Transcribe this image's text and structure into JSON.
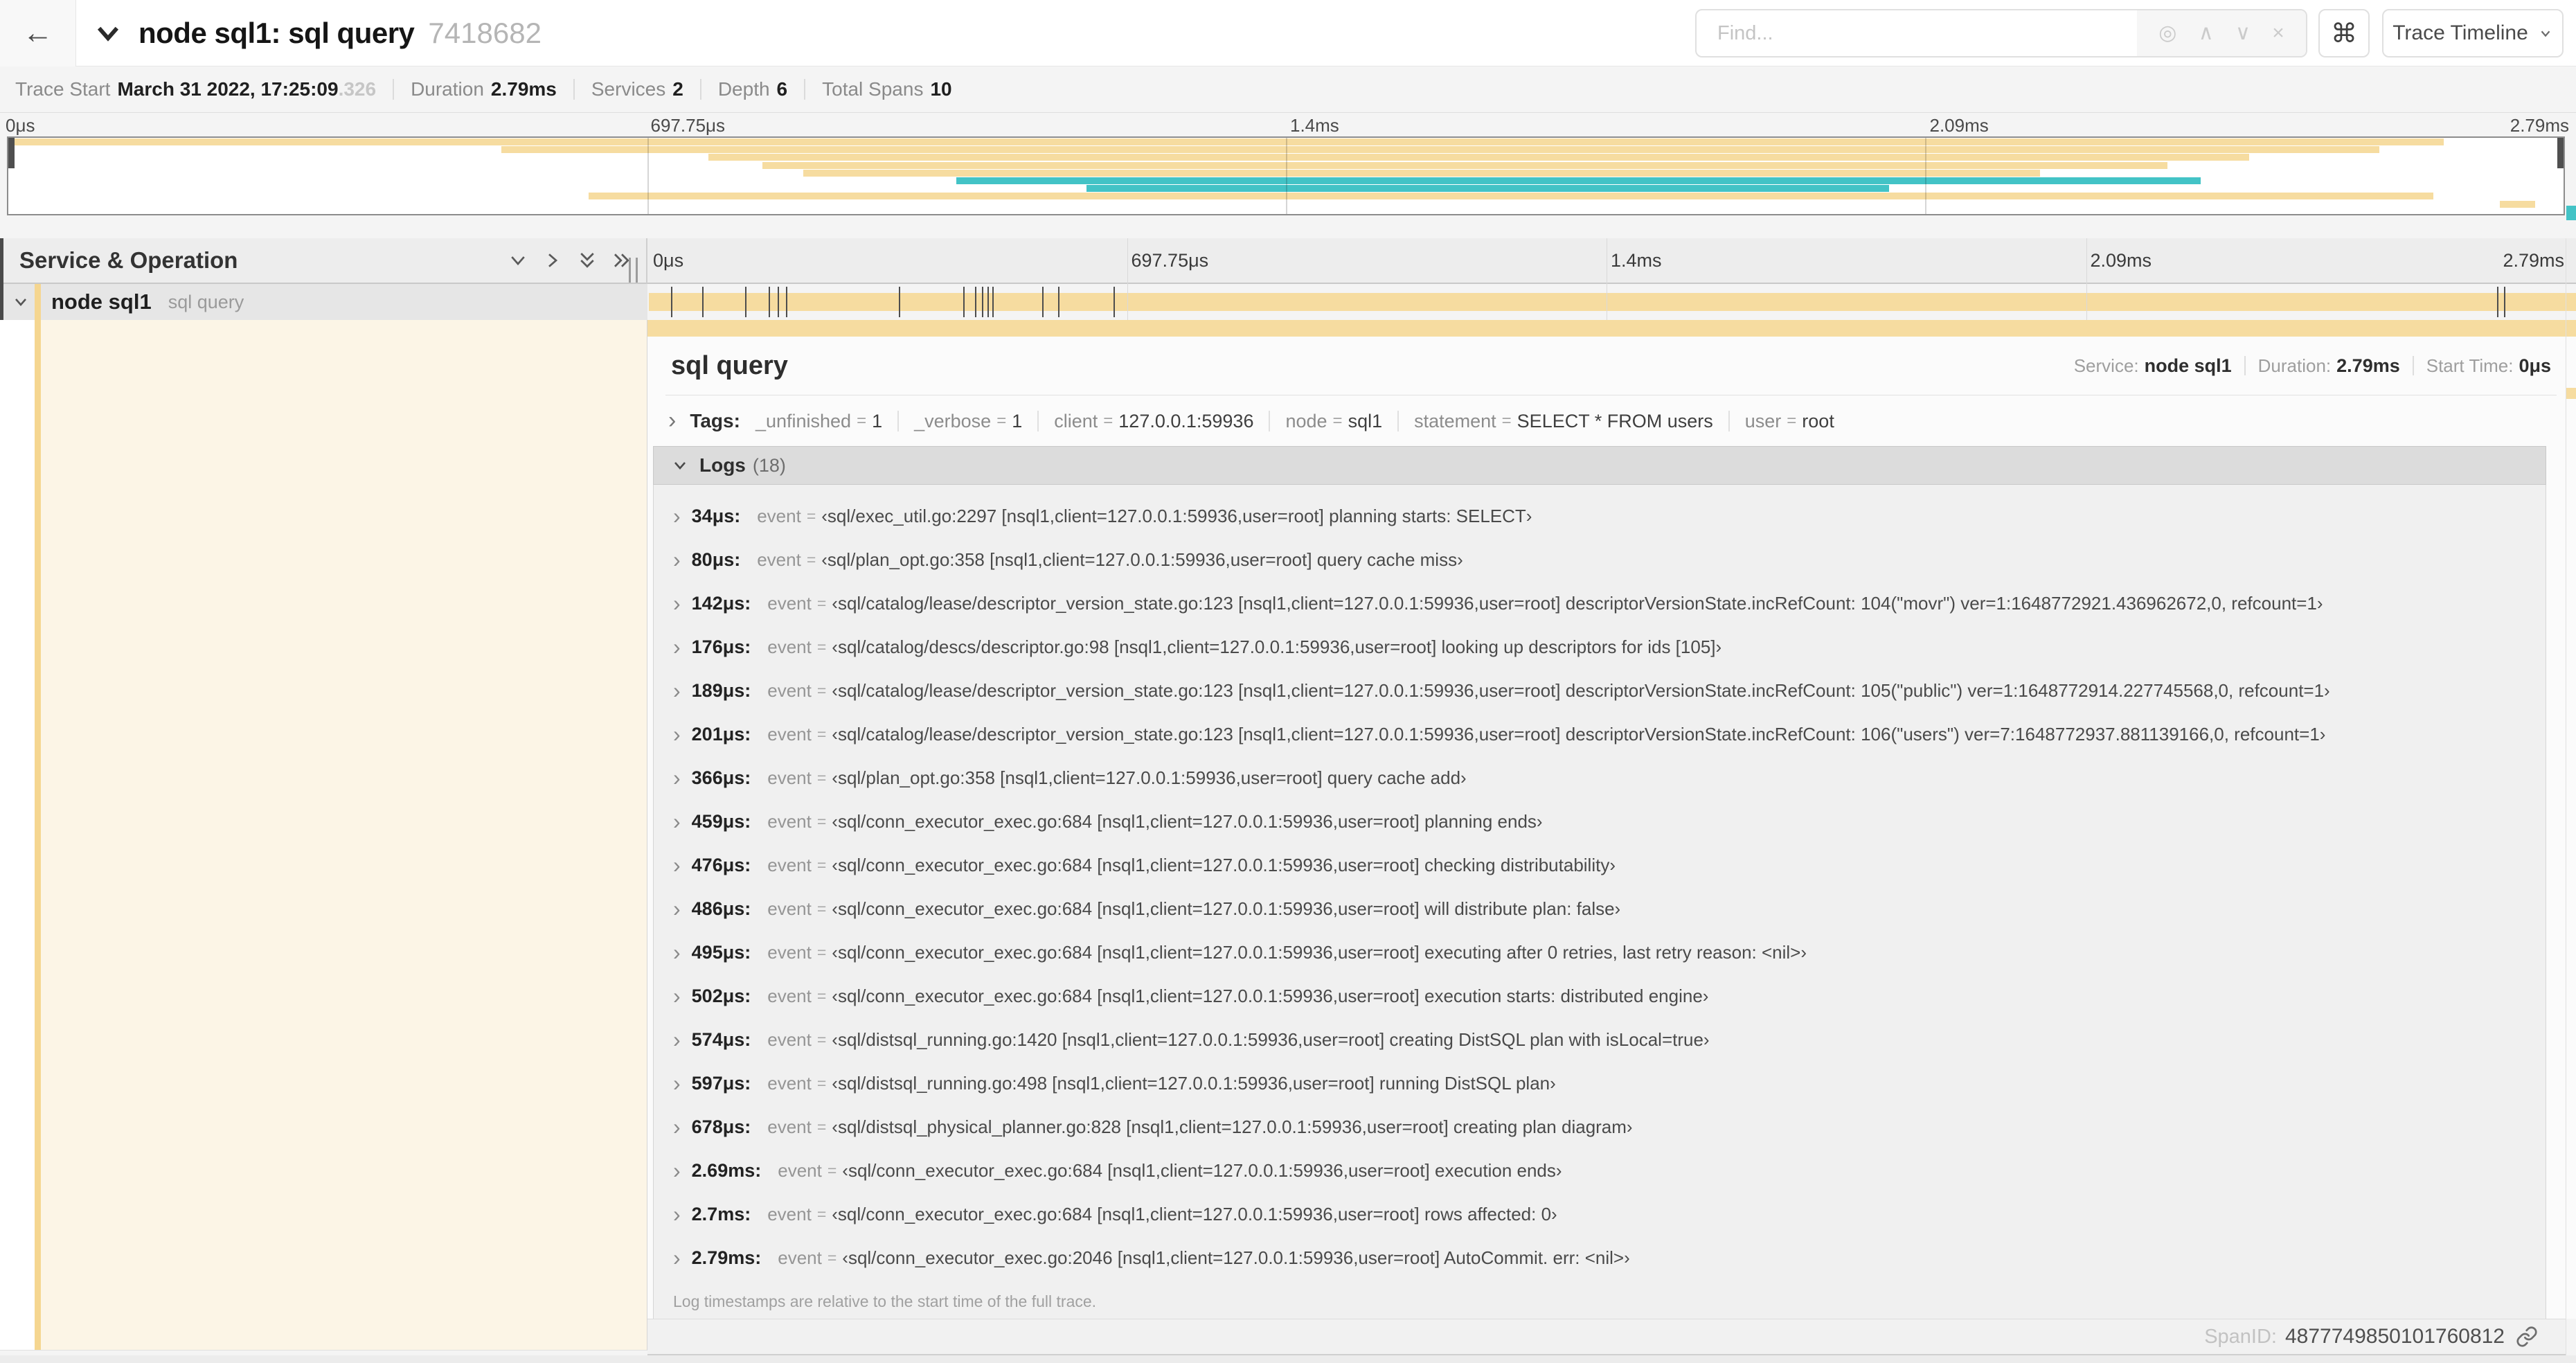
{
  "colors": {
    "span_tan": "#F6DCA0",
    "accent_tan": "#F5D690",
    "span_teal": "#43C3C6",
    "cream": "#FCF5E6"
  },
  "header": {
    "back_icon": "←",
    "title": "node sql1: sql query",
    "trace_id": "7418682",
    "find_placeholder": "Find...",
    "find_icons": [
      "◎",
      "∧",
      "∨",
      "×"
    ],
    "shortcut_icon": "⌘",
    "view_selector_label": "Trace Timeline"
  },
  "trace_info": {
    "items": [
      {
        "label": "Trace Start",
        "value": "March 31 2022, 17:25:09",
        "suffix": ".326"
      },
      {
        "label": "Duration",
        "value": "2.79ms"
      },
      {
        "label": "Services",
        "value": "2"
      },
      {
        "label": "Depth",
        "value": "6"
      },
      {
        "label": "Total Spans",
        "value": "10"
      }
    ]
  },
  "minimap": {
    "ticks": [
      "0μs",
      "697.75μs",
      "1.4ms",
      "2.09ms",
      "2.79ms"
    ],
    "spans": [
      {
        "row": 0,
        "start": 0,
        "end": 95.3,
        "color": "tan"
      },
      {
        "row": 1,
        "start": 19.3,
        "end": 92.8,
        "color": "tan"
      },
      {
        "row": 2,
        "start": 27.4,
        "end": 87.7,
        "color": "tan"
      },
      {
        "row": 3,
        "start": 29.5,
        "end": 84.5,
        "color": "tan"
      },
      {
        "row": 4,
        "start": 31.1,
        "end": 79.5,
        "color": "tan"
      },
      {
        "row": 5,
        "start": 37.1,
        "end": 85.8,
        "color": "teal"
      },
      {
        "row": 6,
        "start": 42.2,
        "end": 73.6,
        "color": "teal"
      },
      {
        "row": 7,
        "start": 22.7,
        "end": 94.9,
        "color": "tan"
      },
      {
        "row": 8,
        "start": 97.5,
        "end": 98.9,
        "color": "tan"
      }
    ]
  },
  "timeline": {
    "left_header": "Service & Operation",
    "ticks": [
      "0μs",
      "697.75μs",
      "1.4ms",
      "2.09ms",
      "2.79ms"
    ],
    "row": {
      "service": "node sql1",
      "operation": "sql query"
    },
    "duration_us": 2790,
    "log_markers_us": [
      34,
      80,
      142,
      176,
      189,
      201,
      366,
      459,
      476,
      486,
      495,
      502,
      574,
      597,
      678,
      2690,
      2700
    ]
  },
  "detail": {
    "operation": "sql query",
    "stats": [
      {
        "label": "Service:",
        "value": "node sql1"
      },
      {
        "label": "Duration:",
        "value": "2.79ms"
      },
      {
        "label": "Start Time:",
        "value": "0μs"
      }
    ],
    "tags_label": "Tags:",
    "tags": [
      {
        "key": "_unfinished",
        "value": "1"
      },
      {
        "key": "_verbose",
        "value": "1"
      },
      {
        "key": "client",
        "value": "127.0.0.1:59936"
      },
      {
        "key": "node",
        "value": "sql1"
      },
      {
        "key": "statement",
        "value": "SELECT * FROM users"
      },
      {
        "key": "user",
        "value": "root"
      }
    ],
    "logs_label": "Logs",
    "logs_count": "(18)",
    "logs": [
      {
        "time": "34μs:",
        "key": "event",
        "value": "‹sql/exec_util.go:2297 [nsql1,client=127.0.0.1:59936,user=root] planning starts: SELECT›"
      },
      {
        "time": "80μs:",
        "key": "event",
        "value": "‹sql/plan_opt.go:358 [nsql1,client=127.0.0.1:59936,user=root] query cache miss›"
      },
      {
        "time": "142μs:",
        "key": "event",
        "value": "‹sql/catalog/lease/descriptor_version_state.go:123 [nsql1,client=127.0.0.1:59936,user=root] descriptorVersionState.incRefCount: 104(\"movr\") ver=1:1648772921.436962672,0, refcount=1›"
      },
      {
        "time": "176μs:",
        "key": "event",
        "value": "‹sql/catalog/descs/descriptor.go:98 [nsql1,client=127.0.0.1:59936,user=root] looking up descriptors for ids [105]›"
      },
      {
        "time": "189μs:",
        "key": "event",
        "value": "‹sql/catalog/lease/descriptor_version_state.go:123 [nsql1,client=127.0.0.1:59936,user=root] descriptorVersionState.incRefCount: 105(\"public\") ver=1:1648772914.227745568,0, refcount=1›"
      },
      {
        "time": "201μs:",
        "key": "event",
        "value": "‹sql/catalog/lease/descriptor_version_state.go:123 [nsql1,client=127.0.0.1:59936,user=root] descriptorVersionState.incRefCount: 106(\"users\") ver=7:1648772937.881139166,0, refcount=1›"
      },
      {
        "time": "366μs:",
        "key": "event",
        "value": "‹sql/plan_opt.go:358 [nsql1,client=127.0.0.1:59936,user=root] query cache add›"
      },
      {
        "time": "459μs:",
        "key": "event",
        "value": "‹sql/conn_executor_exec.go:684 [nsql1,client=127.0.0.1:59936,user=root] planning ends›"
      },
      {
        "time": "476μs:",
        "key": "event",
        "value": "‹sql/conn_executor_exec.go:684 [nsql1,client=127.0.0.1:59936,user=root] checking distributability›"
      },
      {
        "time": "486μs:",
        "key": "event",
        "value": "‹sql/conn_executor_exec.go:684 [nsql1,client=127.0.0.1:59936,user=root] will distribute plan: false›"
      },
      {
        "time": "495μs:",
        "key": "event",
        "value": "‹sql/conn_executor_exec.go:684 [nsql1,client=127.0.0.1:59936,user=root] executing after 0 retries, last retry reason: <nil>›"
      },
      {
        "time": "502μs:",
        "key": "event",
        "value": "‹sql/conn_executor_exec.go:684 [nsql1,client=127.0.0.1:59936,user=root] execution starts: distributed engine›"
      },
      {
        "time": "574μs:",
        "key": "event",
        "value": "‹sql/distsql_running.go:1420 [nsql1,client=127.0.0.1:59936,user=root] creating DistSQL plan with isLocal=true›"
      },
      {
        "time": "597μs:",
        "key": "event",
        "value": "‹sql/distsql_running.go:498 [nsql1,client=127.0.0.1:59936,user=root] running DistSQL plan›"
      },
      {
        "time": "678μs:",
        "key": "event",
        "value": "‹sql/distsql_physical_planner.go:828 [nsql1,client=127.0.0.1:59936,user=root] creating plan diagram›"
      },
      {
        "time": "2.69ms:",
        "key": "event",
        "value": "‹sql/conn_executor_exec.go:684 [nsql1,client=127.0.0.1:59936,user=root] execution ends›"
      },
      {
        "time": "2.7ms:",
        "key": "event",
        "value": "‹sql/conn_executor_exec.go:684 [nsql1,client=127.0.0.1:59936,user=root] rows affected: 0›"
      },
      {
        "time": "2.79ms:",
        "key": "event",
        "value": "‹sql/conn_executor_exec.go:2046 [nsql1,client=127.0.0.1:59936,user=root] AutoCommit. err: <nil>›"
      }
    ],
    "logs_note": "Log timestamps are relative to the start time of the full trace.",
    "span_id_label": "SpanID:",
    "span_id": "4877749850101760812"
  }
}
